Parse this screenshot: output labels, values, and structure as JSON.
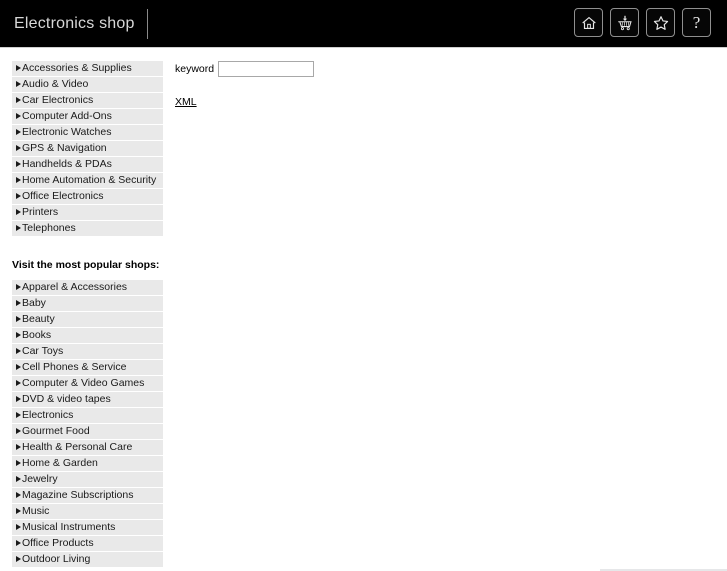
{
  "header": {
    "title": "Electronics shop",
    "icons": [
      {
        "name": "home-icon",
        "label": "Home"
      },
      {
        "name": "cart-icon",
        "label": "Cart"
      },
      {
        "name": "star-icon",
        "label": "Favorites"
      },
      {
        "name": "help-icon",
        "label": "?"
      }
    ]
  },
  "sidebar": {
    "categories": [
      {
        "label": "Accessories & Supplies"
      },
      {
        "label": "Audio & Video"
      },
      {
        "label": "Car Electronics"
      },
      {
        "label": "Computer Add-Ons"
      },
      {
        "label": "Electronic Watches"
      },
      {
        "label": "GPS & Navigation"
      },
      {
        "label": "Handhelds & PDAs"
      },
      {
        "label": "Home Automation & Security"
      },
      {
        "label": "Office Electronics"
      },
      {
        "label": "Printers"
      },
      {
        "label": "Telephones"
      }
    ],
    "popular_heading": "Visit the most popular shops:",
    "popular_shops": [
      {
        "label": "Apparel & Accessories"
      },
      {
        "label": "Baby"
      },
      {
        "label": "Beauty"
      },
      {
        "label": "Books"
      },
      {
        "label": "Car Toys"
      },
      {
        "label": "Cell Phones & Service"
      },
      {
        "label": "Computer & Video Games"
      },
      {
        "label": "DVD & video tapes"
      },
      {
        "label": "Electronics"
      },
      {
        "label": "Gourmet Food"
      },
      {
        "label": "Health & Personal Care"
      },
      {
        "label": "Home & Garden"
      },
      {
        "label": "Jewelry"
      },
      {
        "label": "Magazine Subscriptions"
      },
      {
        "label": "Music"
      },
      {
        "label": "Musical Instruments"
      },
      {
        "label": "Office Products"
      },
      {
        "label": "Outdoor Living"
      }
    ]
  },
  "main": {
    "keyword_label": "keyword",
    "keyword_value": "",
    "keyword_placeholder": "",
    "xml_link": "XML"
  },
  "colors": {
    "header_bg": "#000000",
    "header_text": "#d8d8d8",
    "list_bg": "#e9e9e9",
    "rule": "#e6e7e9"
  }
}
